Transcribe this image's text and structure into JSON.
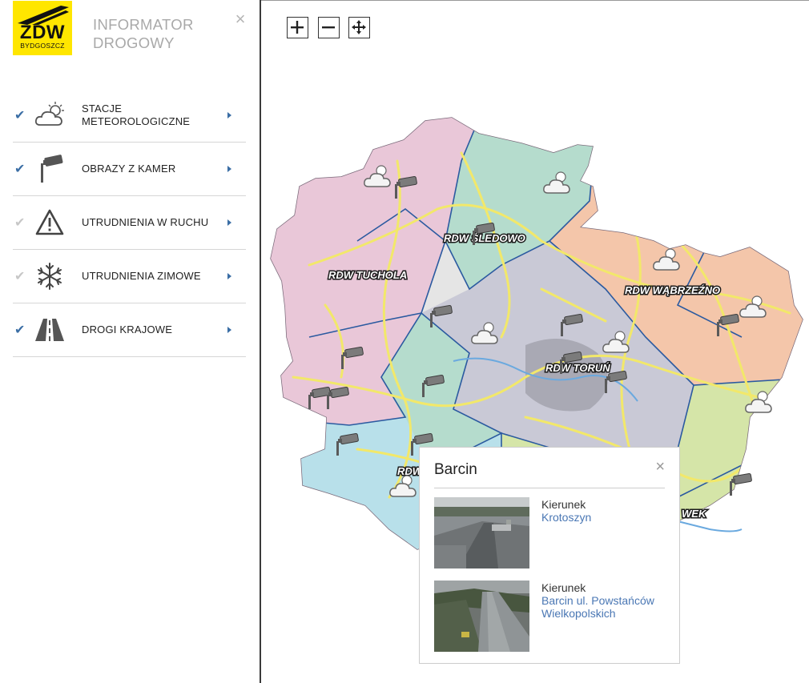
{
  "app": {
    "logo_text": "ZDW",
    "logo_city": "BYDGOSZCZ",
    "title_line1": "INFORMATOR",
    "title_line2": "DROGOWY",
    "close_glyph": "×",
    "brand_color": "#ffe600"
  },
  "layers": [
    {
      "label": "STACJE METEOROLOGICZNE",
      "icon": "weather-cloud-icon",
      "checked": true
    },
    {
      "label": "OBRAZY Z KAMER",
      "icon": "camera-icon",
      "checked": true
    },
    {
      "label": "UTRUDNIENIA W RUCHU",
      "icon": "warning-triangle-icon",
      "checked": false
    },
    {
      "label": "UTRUDNIENIA ZIMOWE",
      "icon": "snowflake-icon",
      "checked": false
    },
    {
      "label": "DROGI KRAJOWE",
      "icon": "road-icon",
      "checked": true
    }
  ],
  "map": {
    "controls": [
      "zoom-in",
      "zoom-out",
      "pan"
    ],
    "regions": [
      "RDW TUCHOLA",
      "RDW ŚLEDOWO",
      "RDW WĄBRZEŹNO",
      "RDW TORUŃ",
      "RDW",
      "WEK"
    ],
    "colors": {
      "tuchola": "#e9c7d8",
      "sledowo": "#b5dccd",
      "wabrzezno": "#f4c6aa",
      "torun": "#c9c9d6",
      "south": "#b8e0ea",
      "east": "#d5e5a8",
      "roads": "#f2e86a",
      "borders": "#2b5aa0"
    }
  },
  "popup": {
    "title": "Barcin",
    "close_glyph": "×",
    "cameras": [
      {
        "label": "Kierunek",
        "direction": "Krotoszyn"
      },
      {
        "label": "Kierunek",
        "direction": "Barcin ul. Powstańców Wielkopolskich"
      }
    ]
  }
}
